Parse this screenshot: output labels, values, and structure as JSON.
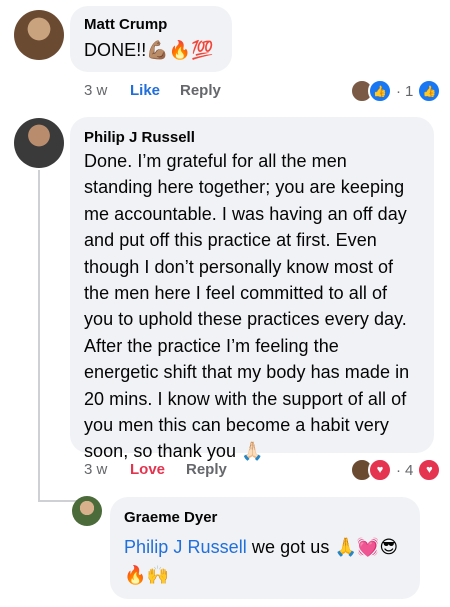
{
  "comments": [
    {
      "author": "Matt Crump",
      "text": "DONE!!💪🏽🔥💯",
      "time": "3 w",
      "action_label": "Like",
      "reply_label": "Reply",
      "reaction_count": "1",
      "reactions": [
        "like-icon"
      ],
      "reaction_color": "#1877f2"
    },
    {
      "author": "Philip J Russell",
      "text_lines": [
        "Done. I’m grateful for all the men",
        "standing here together; you are keeping",
        "me accountable. I was having an off day",
        "and put off this practice at first. Even",
        "though I don’t personally know most of",
        "the men here I feel committed to all of",
        "you to uphold these practices every day.",
        "After the practice I’m feeling the",
        "energetic shift that my body has made in",
        "20 mins. I know with the support of all of",
        "you men this can become a habit very",
        "soon, so thank you 🙏🏻"
      ],
      "time": "3 w",
      "action_label": "Love",
      "reply_label": "Reply",
      "reaction_count": "4",
      "reactions": [
        "love-icon"
      ],
      "reaction_color": "#e4344f"
    }
  ],
  "reply": {
    "author": "Graeme Dyer",
    "mention": "Philip J Russell",
    "text": " we got us 🙏💓😎",
    "text_line2": "🔥🙌"
  },
  "separator": "·",
  "colors": {
    "bubble": "#f0f2f5",
    "link": "#216fdb",
    "love": "#e4344f",
    "meta": "#65676b"
  }
}
